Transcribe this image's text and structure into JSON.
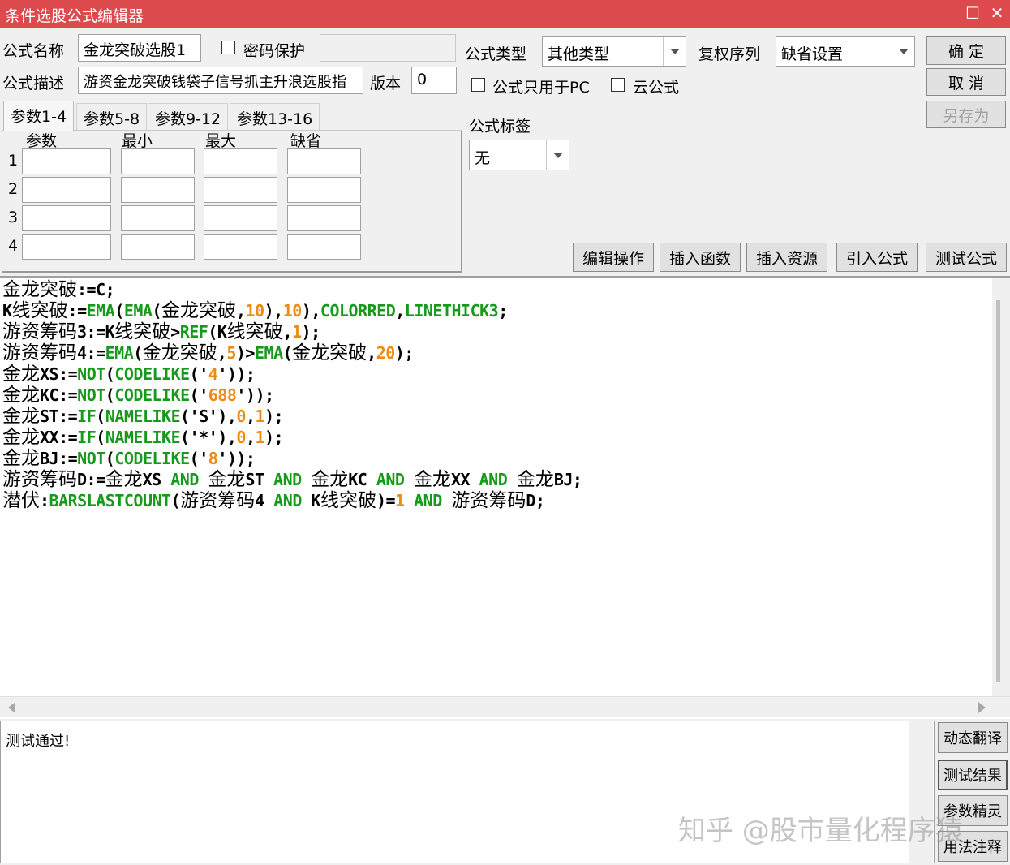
{
  "window": {
    "title": "条件选股公式编辑器",
    "maximize_icon": "☐",
    "close_icon": "✕",
    "title_bar_color": "#dd4a4e"
  },
  "form": {
    "name_label": "公式名称",
    "name_value": "金龙突破选股1",
    "password_label": "密码保护",
    "password_value": "",
    "desc_label": "公式描述",
    "desc_value": "游资金龙突破钱袋子信号抓主升浪选股指",
    "version_label": "版本",
    "version_value": "0",
    "type_label": "公式类型",
    "type_value": "其他类型",
    "restore_label": "复权序列",
    "restore_value": "缺省设置",
    "pc_only_label": "公式只用于PC",
    "cloud_label": "云公式",
    "tag_label": "公式标签",
    "tag_value": "无"
  },
  "buttons": {
    "ok": "确 定",
    "cancel": "取 消",
    "save_as": "另存为",
    "edit_ops": "编辑操作",
    "insert_func": "插入函数",
    "insert_res": "插入资源",
    "import_formula": "引入公式",
    "test_formula": "测试公式",
    "dynamic_translate": "动态翻译",
    "test_result": "测试结果",
    "param_wizard": "参数精灵",
    "usage_notes": "用法注释"
  },
  "param_tabs": [
    "参数1-4",
    "参数5-8",
    "参数9-12",
    "参数13-16"
  ],
  "param_headers": [
    "参数",
    "最小",
    "最大",
    "缺省"
  ],
  "param_rows": [
    "1",
    "2",
    "3",
    "4"
  ],
  "code_lines": [
    [
      {
        "t": "金龙突破",
        "c": "cn"
      },
      {
        "t": ":=C;",
        "c": "k"
      }
    ],
    [
      {
        "t": "K",
        "c": "k"
      },
      {
        "t": "线突破",
        "c": "cn"
      },
      {
        "t": ":=",
        "c": "k"
      },
      {
        "t": "EMA",
        "c": "g"
      },
      {
        "t": "(",
        "c": "k"
      },
      {
        "t": "EMA",
        "c": "g"
      },
      {
        "t": "(",
        "c": "k"
      },
      {
        "t": "金龙突破",
        "c": "cn"
      },
      {
        "t": ",",
        "c": "k"
      },
      {
        "t": "10",
        "c": "o"
      },
      {
        "t": "),",
        "c": "k"
      },
      {
        "t": "10",
        "c": "o"
      },
      {
        "t": "),",
        "c": "k"
      },
      {
        "t": "COLORRED",
        "c": "g"
      },
      {
        "t": ",",
        "c": "k"
      },
      {
        "t": "LINETHICK3",
        "c": "g"
      },
      {
        "t": ";",
        "c": "k"
      }
    ],
    [
      {
        "t": "游资筹码",
        "c": "cn"
      },
      {
        "t": "3:=K",
        "c": "k"
      },
      {
        "t": "线突破",
        "c": "cn"
      },
      {
        "t": ">",
        "c": "k"
      },
      {
        "t": "REF",
        "c": "g"
      },
      {
        "t": "(K",
        "c": "k"
      },
      {
        "t": "线突破",
        "c": "cn"
      },
      {
        "t": ",",
        "c": "k"
      },
      {
        "t": "1",
        "c": "o"
      },
      {
        "t": ");",
        "c": "k"
      }
    ],
    [
      {
        "t": "游资筹码",
        "c": "cn"
      },
      {
        "t": "4:=",
        "c": "k"
      },
      {
        "t": "EMA",
        "c": "g"
      },
      {
        "t": "(",
        "c": "k"
      },
      {
        "t": "金龙突破",
        "c": "cn"
      },
      {
        "t": ",",
        "c": "k"
      },
      {
        "t": "5",
        "c": "o"
      },
      {
        "t": ")>",
        "c": "k"
      },
      {
        "t": "EMA",
        "c": "g"
      },
      {
        "t": "(",
        "c": "k"
      },
      {
        "t": "金龙突破",
        "c": "cn"
      },
      {
        "t": ",",
        "c": "k"
      },
      {
        "t": "20",
        "c": "o"
      },
      {
        "t": ");",
        "c": "k"
      }
    ],
    [
      {
        "t": "金龙",
        "c": "cn"
      },
      {
        "t": "XS:=",
        "c": "k"
      },
      {
        "t": "NOT",
        "c": "g"
      },
      {
        "t": "(",
        "c": "k"
      },
      {
        "t": "CODELIKE",
        "c": "g"
      },
      {
        "t": "('",
        "c": "k"
      },
      {
        "t": "4",
        "c": "o"
      },
      {
        "t": "'));",
        "c": "k"
      }
    ],
    [
      {
        "t": "金龙",
        "c": "cn"
      },
      {
        "t": "KC:=",
        "c": "k"
      },
      {
        "t": "NOT",
        "c": "g"
      },
      {
        "t": "(",
        "c": "k"
      },
      {
        "t": "CODELIKE",
        "c": "g"
      },
      {
        "t": "('",
        "c": "k"
      },
      {
        "t": "688",
        "c": "o"
      },
      {
        "t": "'));",
        "c": "k"
      }
    ],
    [
      {
        "t": "金龙",
        "c": "cn"
      },
      {
        "t": "ST:=",
        "c": "k"
      },
      {
        "t": "IF",
        "c": "g"
      },
      {
        "t": "(",
        "c": "k"
      },
      {
        "t": "NAMELIKE",
        "c": "g"
      },
      {
        "t": "('S'),",
        "c": "k"
      },
      {
        "t": "0",
        "c": "o"
      },
      {
        "t": ",",
        "c": "k"
      },
      {
        "t": "1",
        "c": "o"
      },
      {
        "t": ");",
        "c": "k"
      }
    ],
    [
      {
        "t": "金龙",
        "c": "cn"
      },
      {
        "t": "XX:=",
        "c": "k"
      },
      {
        "t": "IF",
        "c": "g"
      },
      {
        "t": "(",
        "c": "k"
      },
      {
        "t": "NAMELIKE",
        "c": "g"
      },
      {
        "t": "('*'),",
        "c": "k"
      },
      {
        "t": "0",
        "c": "o"
      },
      {
        "t": ",",
        "c": "k"
      },
      {
        "t": "1",
        "c": "o"
      },
      {
        "t": ");",
        "c": "k"
      }
    ],
    [
      {
        "t": "金龙",
        "c": "cn"
      },
      {
        "t": "BJ:=",
        "c": "k"
      },
      {
        "t": "NOT",
        "c": "g"
      },
      {
        "t": "(",
        "c": "k"
      },
      {
        "t": "CODELIKE",
        "c": "g"
      },
      {
        "t": "('",
        "c": "k"
      },
      {
        "t": "8",
        "c": "o"
      },
      {
        "t": "'));",
        "c": "k"
      }
    ],
    [
      {
        "t": "游资筹码",
        "c": "cn"
      },
      {
        "t": "D:=",
        "c": "k"
      },
      {
        "t": "金龙",
        "c": "cn"
      },
      {
        "t": "XS ",
        "c": "k"
      },
      {
        "t": "AND",
        "c": "g"
      },
      {
        "t": " ",
        "c": "k"
      },
      {
        "t": "金龙",
        "c": "cn"
      },
      {
        "t": "ST ",
        "c": "k"
      },
      {
        "t": "AND",
        "c": "g"
      },
      {
        "t": " ",
        "c": "k"
      },
      {
        "t": "金龙",
        "c": "cn"
      },
      {
        "t": "KC ",
        "c": "k"
      },
      {
        "t": "AND",
        "c": "g"
      },
      {
        "t": " ",
        "c": "k"
      },
      {
        "t": "金龙",
        "c": "cn"
      },
      {
        "t": "XX ",
        "c": "k"
      },
      {
        "t": "AND",
        "c": "g"
      },
      {
        "t": " ",
        "c": "k"
      },
      {
        "t": "金龙",
        "c": "cn"
      },
      {
        "t": "BJ;",
        "c": "k"
      }
    ],
    [
      {
        "t": "潜伏",
        "c": "cn"
      },
      {
        "t": ":",
        "c": "k"
      },
      {
        "t": "BARSLASTCOUNT",
        "c": "g"
      },
      {
        "t": "(",
        "c": "k"
      },
      {
        "t": "游资筹码",
        "c": "cn"
      },
      {
        "t": "4 ",
        "c": "k"
      },
      {
        "t": "AND",
        "c": "g"
      },
      {
        "t": " K",
        "c": "k"
      },
      {
        "t": "线突破",
        "c": "cn"
      },
      {
        "t": ")=",
        "c": "k"
      },
      {
        "t": "1",
        "c": "o"
      },
      {
        "t": " ",
        "c": "k"
      },
      {
        "t": "AND",
        "c": "g"
      },
      {
        "t": " ",
        "c": "k"
      },
      {
        "t": "游资筹码",
        "c": "cn"
      },
      {
        "t": "D;",
        "c": "k"
      }
    ]
  ],
  "output_text": "测试通过!",
  "watermark": "知乎 @股市量化程序猿"
}
